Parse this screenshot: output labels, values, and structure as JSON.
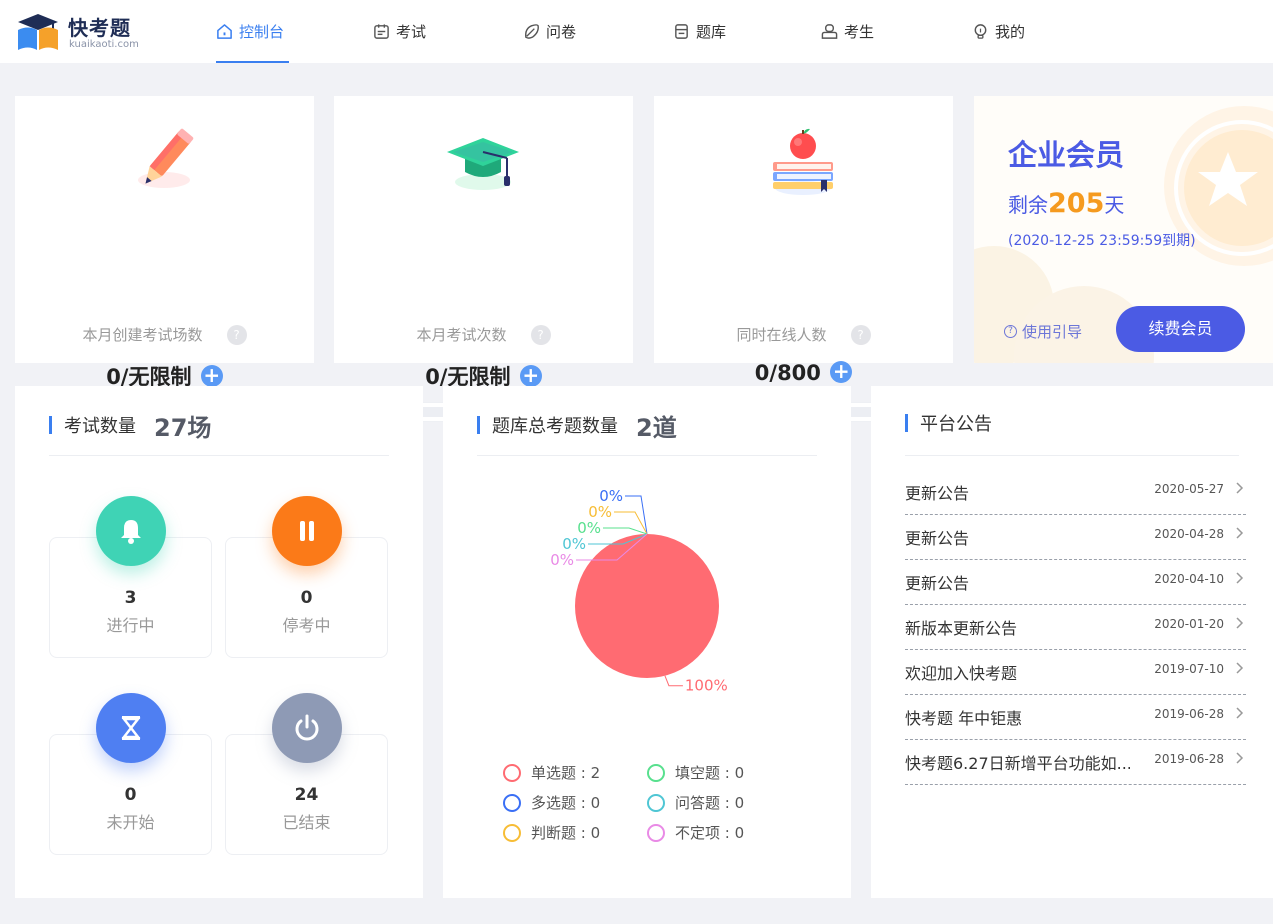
{
  "brand": {
    "name": "快考题",
    "domain": "kuaikaoti.com"
  },
  "nav": [
    {
      "label": "控制台",
      "icon": "home-icon",
      "active": true
    },
    {
      "label": "考试",
      "icon": "calendar-icon"
    },
    {
      "label": "问卷",
      "icon": "questionnaire-icon"
    },
    {
      "label": "题库",
      "icon": "database-icon"
    },
    {
      "label": "考生",
      "icon": "examinee-icon"
    },
    {
      "label": "我的",
      "icon": "lightbulb-icon"
    }
  ],
  "stats": [
    {
      "label": "本月创建考试场数",
      "value": "0/无限制",
      "icon": "pencil-icon"
    },
    {
      "label": "本月考试次数",
      "value": "0/无限制",
      "icon": "graduation-cap-icon"
    },
    {
      "label": "同时在线人数",
      "value": "0/800",
      "icon": "apple-books-icon"
    }
  ],
  "membership": {
    "title": "企业会员",
    "remain_prefix": "剩余",
    "remain_days": "205",
    "remain_suffix": "天",
    "expire": "(2020-12-25 23:59:59到期)",
    "guide_label": "使用引导",
    "renew_label": "续费会员"
  },
  "exam_panel": {
    "title": "考试数量",
    "count": "27场",
    "statuses": [
      {
        "count": "3",
        "label": "进行中",
        "icon": "bell-icon",
        "color": "#3fd3b5"
      },
      {
        "count": "0",
        "label": "停考中",
        "icon": "pause-icon",
        "color": "#fb7a18"
      },
      {
        "count": "0",
        "label": "未开始",
        "icon": "hourglass-icon",
        "color": "#4f7ff2"
      },
      {
        "count": "24",
        "label": "已结束",
        "icon": "power-icon",
        "color": "#8e9ab5"
      }
    ]
  },
  "bank_panel": {
    "title": "题库总考题数量",
    "count": "2道"
  },
  "chart_data": {
    "type": "pie",
    "series": [
      {
        "name": "单选题",
        "value": 2,
        "percent_label": "100%",
        "color": "#ff6b72"
      },
      {
        "name": "多选题",
        "value": 0,
        "percent_label": "0%",
        "color": "#3a6ff5"
      },
      {
        "name": "判断题",
        "value": 0,
        "percent_label": "0%",
        "color": "#f7bd36"
      },
      {
        "name": "填空题",
        "value": 0,
        "percent_label": "0%",
        "color": "#58e08e"
      },
      {
        "name": "问答题",
        "value": 0,
        "percent_label": "0%",
        "color": "#4fc6d4"
      },
      {
        "name": "不定项",
        "value": 0,
        "percent_label": "0%",
        "color": "#e98ae6"
      }
    ],
    "legend": [
      {
        "text": "单选题 : 2",
        "color": "#ff6b72"
      },
      {
        "text": "填空题 : 0",
        "color": "#58e08e"
      },
      {
        "text": "多选题 : 0",
        "color": "#3a6ff5"
      },
      {
        "text": "问答题 : 0",
        "color": "#4fc6d4"
      },
      {
        "text": "判断题 : 0",
        "color": "#f7bd36"
      },
      {
        "text": "不定项 : 0",
        "color": "#e98ae6"
      }
    ]
  },
  "notice_panel": {
    "title": "平台公告",
    "items": [
      {
        "title": "更新公告",
        "date": "2020-05-27"
      },
      {
        "title": "更新公告",
        "date": "2020-04-28"
      },
      {
        "title": "更新公告",
        "date": "2020-04-10"
      },
      {
        "title": "新版本更新公告",
        "date": "2020-01-20"
      },
      {
        "title": "欢迎加入快考题",
        "date": "2019-07-10"
      },
      {
        "title": "快考题 年中钜惠",
        "date": "2019-06-28"
      },
      {
        "title": "快考题6.27日新增平台功能如...",
        "date": "2019-06-28"
      }
    ]
  }
}
